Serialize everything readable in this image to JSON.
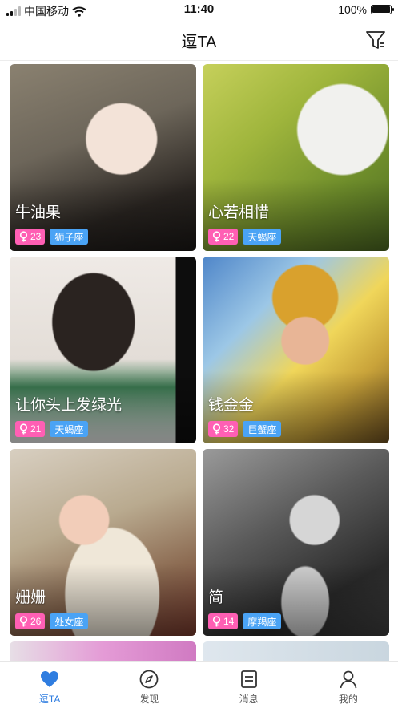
{
  "status_bar": {
    "carrier": "中国移动",
    "time": "11:40",
    "battery": "100%"
  },
  "nav": {
    "title": "逗TA",
    "filter_icon": "filter-icon"
  },
  "cards": [
    {
      "name": "牛油果",
      "age": "23",
      "sign": "狮子座"
    },
    {
      "name": "心若相惜",
      "age": "22",
      "sign": "天蝎座"
    },
    {
      "name": "让你头上发绿光",
      "age": "21",
      "sign": "天蝎座"
    },
    {
      "name": "钱金金",
      "age": "32",
      "sign": "巨蟹座"
    },
    {
      "name": "姗姗",
      "age": "26",
      "sign": "处女座"
    },
    {
      "name": "简",
      "age": "14",
      "sign": "摩羯座"
    }
  ],
  "tabs": [
    {
      "label": "逗TA",
      "icon": "heart-icon",
      "active": true
    },
    {
      "label": "发现",
      "icon": "compass-icon",
      "active": false
    },
    {
      "label": "消息",
      "icon": "message-icon",
      "active": false
    },
    {
      "label": "我的",
      "icon": "user-icon",
      "active": false
    }
  ],
  "colors": {
    "accent": "#2f7de0",
    "gender_tag": "#ff5fb4",
    "sign_tag": "#4aa3f5"
  }
}
